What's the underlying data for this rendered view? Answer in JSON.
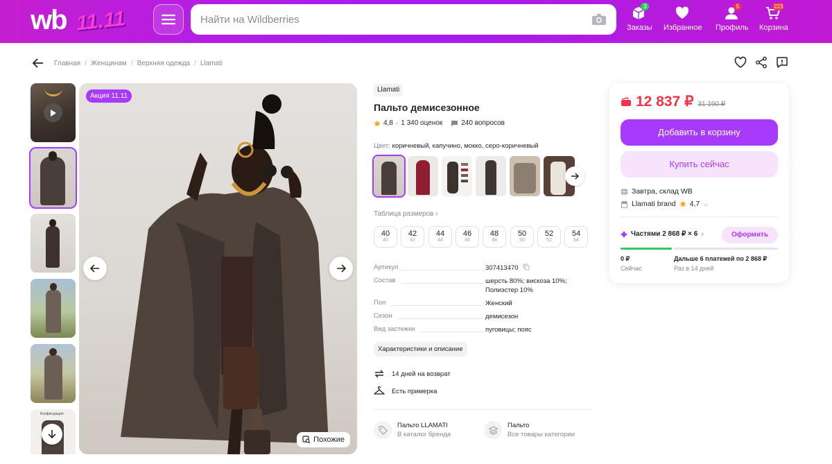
{
  "header": {
    "logo_text": "wb",
    "promo_text": "11.11",
    "search_placeholder": "Найти на Wildberries",
    "nav": [
      {
        "label": "Заказы",
        "badge": "3",
        "badge_color": "#33c75f"
      },
      {
        "label": "Избранное",
        "badge": "",
        "badge_color": ""
      },
      {
        "label": "Профиль",
        "badge": "5",
        "badge_color": "#f1334a"
      },
      {
        "label": "Корзина",
        "badge": "223",
        "badge_color": "#f1334a"
      }
    ]
  },
  "breadcrumb": [
    "Главная",
    "Женщинам",
    "Верхняя одежда",
    "Llamati"
  ],
  "gallery": {
    "promo_badge": "Акция 11.11",
    "similar_label": "Похожие",
    "last_thumb_caption": "Конфигурация"
  },
  "product": {
    "brand": "Llamati",
    "title": "Пальто демисезонное",
    "rating": "4,8",
    "reviews": "1 340 оценок",
    "questions": "240 вопросов",
    "color_label": "Цвет:",
    "colors": "коричневый, капучино, мокко, серо-коричневый",
    "size_table_label": "Таблица размеров",
    "sizes": [
      {
        "ru": "40",
        "eu": "40"
      },
      {
        "ru": "42",
        "eu": "42"
      },
      {
        "ru": "44",
        "eu": "44"
      },
      {
        "ru": "46",
        "eu": "46"
      },
      {
        "ru": "48",
        "eu": "48"
      },
      {
        "ru": "50",
        "eu": "50"
      },
      {
        "ru": "52",
        "eu": "52"
      },
      {
        "ru": "54",
        "eu": "54"
      }
    ],
    "specs": [
      {
        "key": "Артикул",
        "value": "307413470"
      },
      {
        "key": "Состав",
        "value": "шерсть 80%; вискоза 10%; Полиэстер 10%"
      },
      {
        "key": "Пол",
        "value": "Женский"
      },
      {
        "key": "Сезон",
        "value": "демисезон"
      },
      {
        "key": "Вид застежки",
        "value": "пуговицы; пояс"
      }
    ],
    "chars_button": "Характеристики и описание",
    "features": [
      "14 дней на возврат",
      "Есть примерка"
    ],
    "links": [
      {
        "title": "Пальто LLAMATI",
        "sub": "В каталог бренда"
      },
      {
        "title": "Пальто",
        "sub": "Все товары категории"
      }
    ]
  },
  "buybox": {
    "price": "12 837 ₽",
    "old_price": "31 190 ₽",
    "add_to_cart": "Добавить в корзину",
    "buy_now": "Купить сейчас",
    "delivery": "Завтра, склад WB",
    "seller": "Llamati brand",
    "seller_rating": "4,7",
    "installments": "Частями 2 868 ₽ × 6",
    "order_button": "Оформить",
    "pay_now_amount": "0 ₽",
    "pay_now_label": "Сейчас",
    "pay_later_amount": "Дальше 6 платежей по 2 868 ₽",
    "pay_later_label": "Раз в 14 дней"
  },
  "colors_theme": {
    "accent": "#a73afd",
    "price": "#f1334a"
  }
}
